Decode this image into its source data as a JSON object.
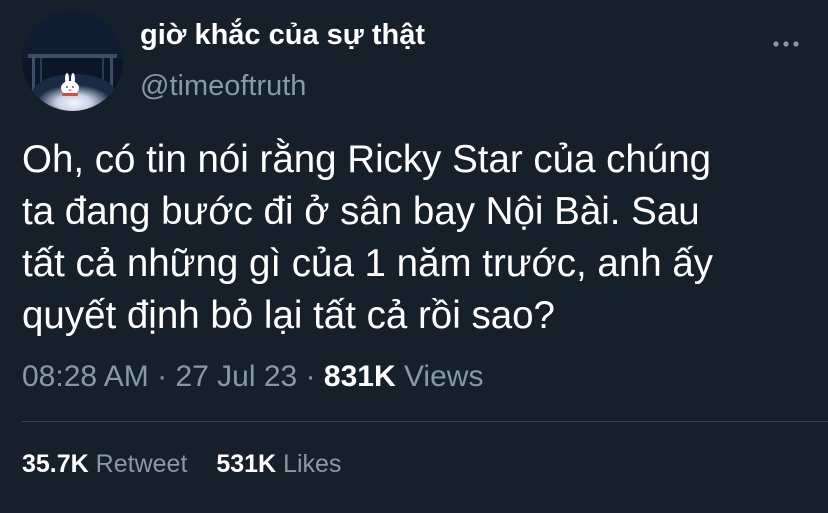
{
  "user": {
    "display_name": "giờ khắc của sự thật",
    "handle": "@timeoftruth",
    "avatar_icon": "sleeping-bunny-avatar"
  },
  "header": {
    "more_icon": "more-horizontal-icon"
  },
  "tweet": {
    "text": "Oh, có tin nói rằng Ricky Star của chúng\nta đang bước đi ở sân bay Nội Bài. Sau\ntất cả những gì của 1 năm trước, anh ấy\nquyết định bỏ lại tất cả rồi sao?",
    "time": "08:28 AM",
    "separator": "·",
    "date": "27 Jul 23",
    "views_count": "831K",
    "views_label": "Views"
  },
  "stats": {
    "retweets_count": "35.7K",
    "retweets_label": "Retweet",
    "likes_count": "531K",
    "likes_label": "Likes"
  },
  "colors": {
    "background": "#15202b",
    "primary_text": "#ffffff",
    "secondary_text": "#8899a6",
    "divider": "#38444d"
  }
}
